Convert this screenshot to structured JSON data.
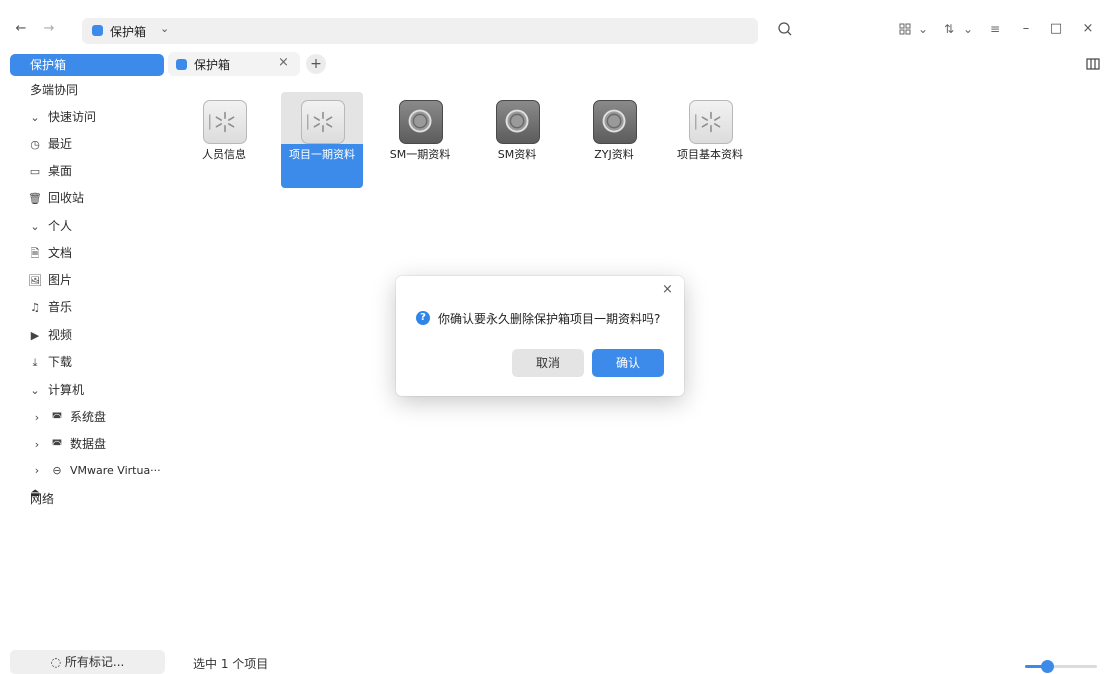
{
  "titlebar": {
    "back_icon": "←",
    "forward_icon": "→",
    "path_label": "保护箱",
    "path_chevron": "⌄",
    "view_menu_chevron": "⌄",
    "sort_icon": "⇅",
    "sort_chevron": "⌄",
    "menu_icon": "≡",
    "minimize_icon": "–",
    "maximize_icon": "□",
    "close_icon": "×"
  },
  "sidebar": {
    "items": [
      {
        "label": "保护箱",
        "icon": "",
        "active": true
      },
      {
        "label": "多端协同",
        "icon": ""
      },
      {
        "label": "快速访问",
        "icon": "⌄",
        "group": true
      },
      {
        "label": "最近",
        "icon": "◷"
      },
      {
        "label": "桌面",
        "icon": "▭"
      },
      {
        "label": "回收站",
        "icon": "🗑"
      },
      {
        "label": "个人",
        "icon": "⌄",
        "group": true
      },
      {
        "label": "文档",
        "icon": "🗎"
      },
      {
        "label": "图片",
        "icon": "🖼"
      },
      {
        "label": "音乐",
        "icon": "♫"
      },
      {
        "label": "视频",
        "icon": "▶"
      },
      {
        "label": "下载",
        "icon": "⤓"
      },
      {
        "label": "计算机",
        "icon": "⌄",
        "group": true
      },
      {
        "label": "系统盘",
        "icon": "›"
      },
      {
        "label": "数据盘",
        "icon": "›"
      },
      {
        "label": "VMware Virtua··· ⏏",
        "icon": "›"
      },
      {
        "label": "网络",
        "icon": ""
      }
    ],
    "tags_button": "◌  所有标记..."
  },
  "tab": {
    "label": "保护箱",
    "close": "×",
    "add": "+"
  },
  "files": [
    {
      "name": "人员信息",
      "kind": "cracked"
    },
    {
      "name": "项目一期资料",
      "kind": "cracked",
      "selected": true
    },
    {
      "name": "SM一期资料",
      "kind": "safe"
    },
    {
      "name": "SM资料",
      "kind": "safe"
    },
    {
      "name": "ZYJ资料",
      "kind": "safe"
    },
    {
      "name": "项目基本资料",
      "kind": "cracked"
    }
  ],
  "dialog": {
    "message": "你确认要永久删除保护箱项目一期资料吗?",
    "question_icon": "?",
    "close": "×",
    "cancel": "取消",
    "confirm": "确认"
  },
  "statusbar": {
    "text": "选中 1 个项目",
    "zoom_level": 0.3
  },
  "colors": {
    "accent": "#3c8bea"
  }
}
